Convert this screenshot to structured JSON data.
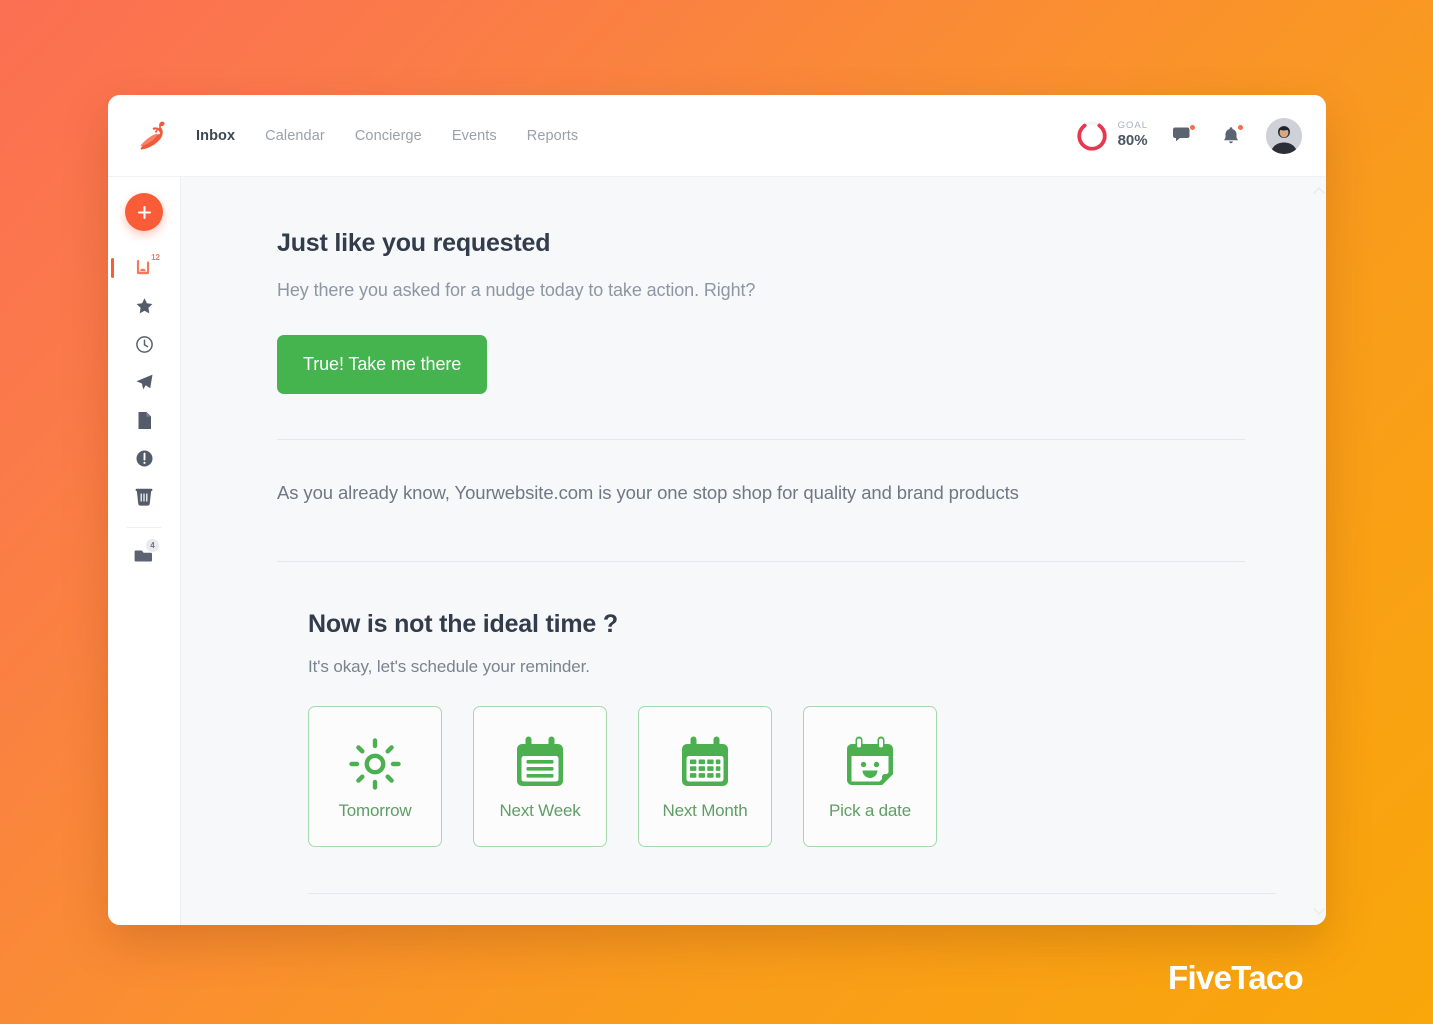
{
  "brand": {
    "logo_icon": "chili-pepper-icon",
    "footer_wordmark": "FiveTaco"
  },
  "topnav": {
    "items": [
      {
        "label": "Inbox",
        "active": true
      },
      {
        "label": "Calendar",
        "active": false
      },
      {
        "label": "Concierge",
        "active": false
      },
      {
        "label": "Events",
        "active": false
      },
      {
        "label": "Reports",
        "active": false
      }
    ],
    "goal": {
      "label": "GOAL",
      "value": "80%",
      "percent": 80,
      "ring_color": "#e8384f"
    },
    "chat_icon": "chat-bubble-icon",
    "bell_icon": "bell-icon",
    "avatar_icon": "user-avatar"
  },
  "sidebar": {
    "add_button": {
      "icon": "plus-icon",
      "color": "#fb5c38"
    },
    "items": [
      {
        "icon": "inbox-icon",
        "badge": "12",
        "active": true
      },
      {
        "icon": "star-icon",
        "badge": "",
        "active": false
      },
      {
        "icon": "clock-icon",
        "badge": "",
        "active": false
      },
      {
        "icon": "send-icon",
        "badge": "",
        "active": false
      },
      {
        "icon": "document-icon",
        "badge": "",
        "active": false
      },
      {
        "icon": "alert-circle-icon",
        "badge": "",
        "active": false
      },
      {
        "icon": "trash-icon",
        "badge": "",
        "active": false
      }
    ],
    "footer_items": [
      {
        "icon": "tag-folder-icon",
        "badge": "4",
        "active": false
      }
    ]
  },
  "main": {
    "heading": "Just like you requested",
    "lead": "Hey there you asked for a nudge today to take action. Right?",
    "cta_label": "True! Take me there",
    "cta_color": "#45b34e",
    "body_text": "As you already know, Yourwebsite.com is your one stop shop for quality and brand products",
    "schedule": {
      "heading": "Now is not the ideal time ?",
      "subtext": "It's okay, let's schedule your reminder.",
      "options": [
        {
          "label": "Tomorrow",
          "icon": "sun-icon"
        },
        {
          "label": "Next Week",
          "icon": "calendar-lines-icon"
        },
        {
          "label": "Next Month",
          "icon": "calendar-grid-icon"
        },
        {
          "label": "Pick a date",
          "icon": "calendar-smiley-icon"
        }
      ]
    }
  }
}
